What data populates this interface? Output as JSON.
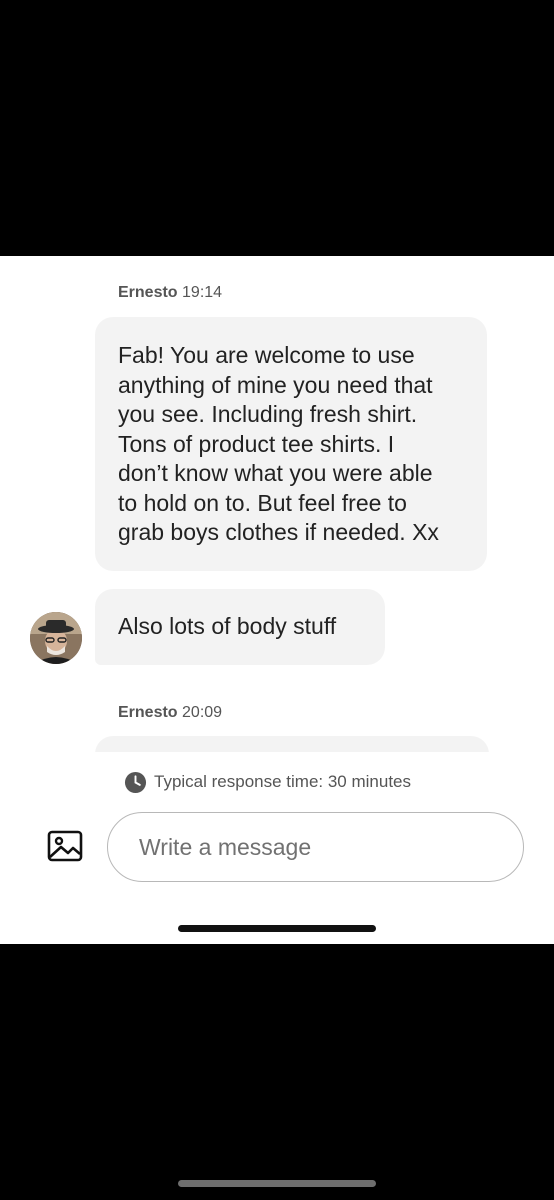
{
  "thread": {
    "messages": [
      {
        "sender": "Ernesto",
        "time": "19:14",
        "lines": [
          "Fab!  You are welcome to use",
          "anything of mine you need that",
          "you see. Including fresh shirt.",
          "Tons of product tee shirts. I",
          "don’t know what you were able",
          "to hold on to. But feel free to",
          "grab boys clothes if needed. Xx"
        ]
      },
      {
        "text": "Also lots of body stuff"
      },
      {
        "sender": "Ernesto",
        "time": "20:09"
      }
    ]
  },
  "footer": {
    "response_time": "Typical response time: 30 minutes",
    "input_placeholder": "Write a message",
    "icons": {
      "clock": "clock-icon",
      "image": "image-icon"
    }
  },
  "colors": {
    "bubble_bg": "#f3f3f3",
    "text": "#222222",
    "meta_text": "#555555",
    "input_border": "#b8b8b8"
  }
}
